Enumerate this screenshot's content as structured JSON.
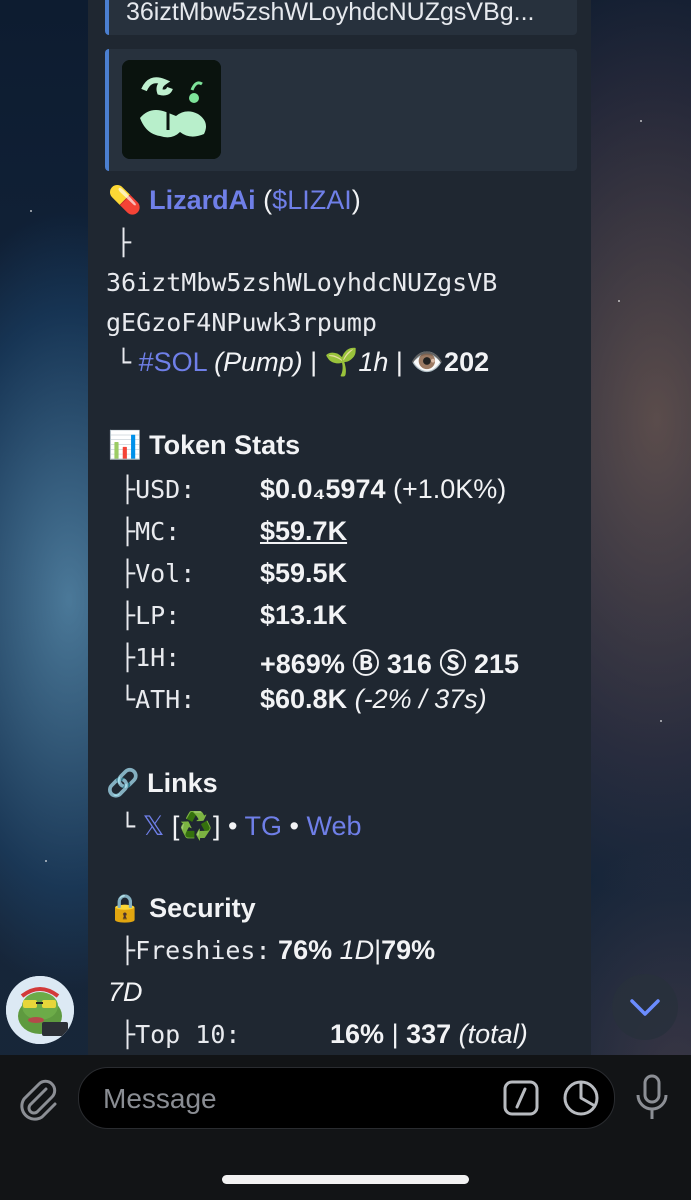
{
  "message": {
    "quoted_address": "36iztMbw5zshWLoyhdcNUZgsVBg...",
    "pill_emoji": "💊",
    "token_name": "LizardAi",
    "token_ticker": "$LIZAI",
    "branch_top": "├",
    "contract_line1": "36iztMbw5zshWLoyhdcNUZgsVB",
    "contract_line2": "gEGzoF4NPuwk3rpump",
    "branch_end": "└",
    "chain_tag": "#SOL",
    "platform": "(Pump)",
    "sep": "|",
    "seedling_emoji": "🌱",
    "age": "1h",
    "eye_emoji": "👁️",
    "views": "202",
    "stats": {
      "heading_emoji": "📊",
      "heading": "Token Stats",
      "rows": [
        {
          "branch": "├",
          "label": "USD:",
          "value": "$0.0₄5974",
          "extra": "(+1.0K%)"
        },
        {
          "branch": "├",
          "label": "MC:",
          "value": "$59.7K"
        },
        {
          "branch": "├",
          "label": "Vol:",
          "value": "$59.5K"
        },
        {
          "branch": "├",
          "label": "LP:",
          "value": "$13.1K"
        },
        {
          "branch": "├",
          "label": "1H:",
          "value": "+869%",
          "buy_icon": "Ⓑ",
          "buys": "316",
          "sell_icon": "Ⓢ",
          "sells": "215"
        },
        {
          "branch": "└",
          "label": "ATH:",
          "value": "$60.8K",
          "extra": "(-2% / 37s)"
        }
      ]
    },
    "links": {
      "heading_emoji": "🔗",
      "heading": "Links",
      "branch": "└",
      "x_label": "𝕏",
      "x_extra_open": "[",
      "x_extra_icon": "♻️",
      "x_extra_close": "]",
      "dot": "•",
      "tg_label": "TG",
      "web_label": "Web"
    },
    "security": {
      "heading_emoji": "🔒",
      "heading": "Security",
      "freshies_branch": "├",
      "freshies_label": "Freshies:",
      "freshies_1d": "76%",
      "freshies_1d_unit": "1D",
      "sep": "|",
      "freshies_7d": "79%",
      "freshies_7d_unit": "7D",
      "top10_branch": "├",
      "top10_label": "Top 10:",
      "top10_pct": "16%",
      "top10_total": "337",
      "top10_total_label": "(total)"
    }
  },
  "composer": {
    "placeholder": "Message"
  },
  "icons": {
    "attach": "paperclip-icon",
    "command": "slash-command-icon",
    "sticker": "sticker-icon",
    "mic": "microphone-icon",
    "scroll": "chevron-down-icon"
  }
}
